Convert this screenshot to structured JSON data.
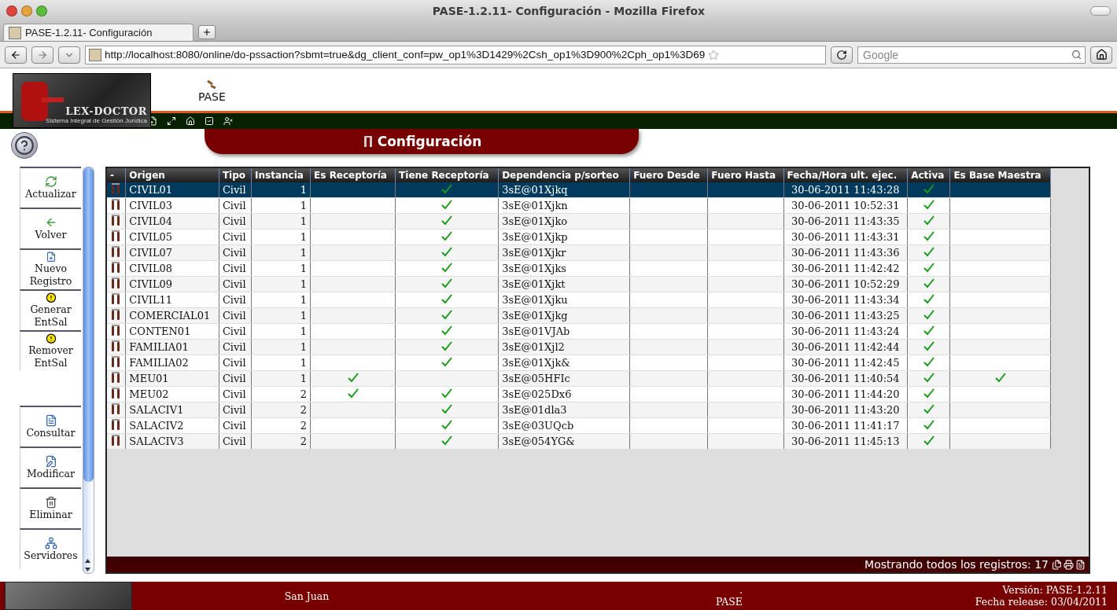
{
  "browser": {
    "window_title": "PASE-1.2.11- Configuración - Mozilla Firefox",
    "tabs": [
      {
        "label": "PASE-1.2.11- Configuración",
        "selected": true
      }
    ],
    "url": "http://localhost:8080/online/do-pssaction?sbmt=true&dg_client_conf=pw_op1%3D1429%2Csh_op1%3D900%2Cph_op1%3D69",
    "search": {
      "placeholder": "Google"
    }
  },
  "header": {
    "logo_title": "LEX-DOCTOR",
    "logo_subtitle": "Sistema Integral de Gestión Jurídica",
    "app_menu": [
      {
        "label": "PASE"
      }
    ]
  },
  "page_title": "Configuración",
  "side_groups": [
    {
      "items": [
        {
          "label": "Actualizar",
          "kind": "refresh"
        },
        {
          "label": "Volver",
          "kind": "back"
        },
        {
          "label": "Nuevo Registro",
          "kind": "new"
        },
        {
          "label": "Generar EntSal",
          "kind": "warning"
        },
        {
          "label": "Remover EntSal",
          "kind": "warning"
        }
      ]
    },
    {
      "items": [
        {
          "label": "Consultar",
          "kind": "query"
        },
        {
          "label": "Modificar",
          "kind": "edit"
        },
        {
          "label": "Eliminar",
          "kind": "delete"
        },
        {
          "label": "Servidores",
          "kind": "servers"
        }
      ]
    }
  ],
  "table": {
    "columns": [
      "-",
      "Origen",
      "Tipo",
      "Instancia",
      "Es Receptoría",
      "Tiene Receptoría",
      "Dependencia p/sorteo",
      "Fuero Desde",
      "Fuero Hasta",
      "Fecha/Hora ult. ejec.",
      "Activa",
      "Es Base Maestra"
    ],
    "rows": [
      {
        "origen": "CIVIL01",
        "tipo": "Civil",
        "instancia": "1",
        "es_receptoria": false,
        "tiene_receptoria": true,
        "dependencia": "3sE@01Xjkq",
        "fecha": "30-06-2011 11:43:28",
        "activa": true,
        "es_base_maestra": false,
        "selected": true
      },
      {
        "origen": "CIVIL03",
        "tipo": "Civil",
        "instancia": "1",
        "es_receptoria": false,
        "tiene_receptoria": true,
        "dependencia": "3sE@01Xjkn",
        "fecha": "30-06-2011 10:52:31",
        "activa": true,
        "es_base_maestra": false,
        "selected": false
      },
      {
        "origen": "CIVIL04",
        "tipo": "Civil",
        "instancia": "1",
        "es_receptoria": false,
        "tiene_receptoria": true,
        "dependencia": "3sE@01Xjko",
        "fecha": "30-06-2011 11:43:35",
        "activa": true,
        "es_base_maestra": false,
        "selected": false
      },
      {
        "origen": "CIVIL05",
        "tipo": "Civil",
        "instancia": "1",
        "es_receptoria": false,
        "tiene_receptoria": true,
        "dependencia": "3sE@01Xjkp",
        "fecha": "30-06-2011 11:43:31",
        "activa": true,
        "es_base_maestra": false,
        "selected": false
      },
      {
        "origen": "CIVIL07",
        "tipo": "Civil",
        "instancia": "1",
        "es_receptoria": false,
        "tiene_receptoria": true,
        "dependencia": "3sE@01Xjkr",
        "fecha": "30-06-2011 11:43:36",
        "activa": true,
        "es_base_maestra": false,
        "selected": false
      },
      {
        "origen": "CIVIL08",
        "tipo": "Civil",
        "instancia": "1",
        "es_receptoria": false,
        "tiene_receptoria": true,
        "dependencia": "3sE@01Xjks",
        "fecha": "30-06-2011 11:42:42",
        "activa": true,
        "es_base_maestra": false,
        "selected": false
      },
      {
        "origen": "CIVIL09",
        "tipo": "Civil",
        "instancia": "1",
        "es_receptoria": false,
        "tiene_receptoria": true,
        "dependencia": "3sE@01Xjkt",
        "fecha": "30-06-2011 10:52:29",
        "activa": true,
        "es_base_maestra": false,
        "selected": false
      },
      {
        "origen": "CIVIL11",
        "tipo": "Civil",
        "instancia": "1",
        "es_receptoria": false,
        "tiene_receptoria": true,
        "dependencia": "3sE@01Xjku",
        "fecha": "30-06-2011 11:43:34",
        "activa": true,
        "es_base_maestra": false,
        "selected": false
      },
      {
        "origen": "COMERCIAL01",
        "tipo": "Civil",
        "instancia": "1",
        "es_receptoria": false,
        "tiene_receptoria": true,
        "dependencia": "3sE@01Xjkg",
        "fecha": "30-06-2011 11:43:25",
        "activa": true,
        "es_base_maestra": false,
        "selected": false
      },
      {
        "origen": "CONTEN01",
        "tipo": "Civil",
        "instancia": "1",
        "es_receptoria": false,
        "tiene_receptoria": true,
        "dependencia": "3sE@01VJAb",
        "fecha": "30-06-2011 11:43:24",
        "activa": true,
        "es_base_maestra": false,
        "selected": false
      },
      {
        "origen": "FAMILIA01",
        "tipo": "Civil",
        "instancia": "1",
        "es_receptoria": false,
        "tiene_receptoria": true,
        "dependencia": "3sE@01Xjl2",
        "fecha": "30-06-2011 11:42:44",
        "activa": true,
        "es_base_maestra": false,
        "selected": false
      },
      {
        "origen": "FAMILIA02",
        "tipo": "Civil",
        "instancia": "1",
        "es_receptoria": false,
        "tiene_receptoria": true,
        "dependencia": "3sE@01Xjk&",
        "fecha": "30-06-2011 11:42:45",
        "activa": true,
        "es_base_maestra": false,
        "selected": false
      },
      {
        "origen": "MEU01",
        "tipo": "Civil",
        "instancia": "1",
        "es_receptoria": true,
        "tiene_receptoria": false,
        "dependencia": "3sE@05HFIc",
        "fecha": "30-06-2011 11:40:54",
        "activa": true,
        "es_base_maestra": true,
        "selected": false
      },
      {
        "origen": "MEU02",
        "tipo": "Civil",
        "instancia": "2",
        "es_receptoria": true,
        "tiene_receptoria": true,
        "dependencia": "3sE@025Dx6",
        "fecha": "30-06-2011 11:44:20",
        "activa": true,
        "es_base_maestra": false,
        "selected": false
      },
      {
        "origen": "SALACIV1",
        "tipo": "Civil",
        "instancia": "2",
        "es_receptoria": false,
        "tiene_receptoria": true,
        "dependencia": "3sE@01dla3",
        "fecha": "30-06-2011 11:43:20",
        "activa": true,
        "es_base_maestra": false,
        "selected": false
      },
      {
        "origen": "SALACIV2",
        "tipo": "Civil",
        "instancia": "2",
        "es_receptoria": false,
        "tiene_receptoria": true,
        "dependencia": "3sE@03UQcb",
        "fecha": "30-06-2011 11:41:17",
        "activa": true,
        "es_base_maestra": false,
        "selected": false
      },
      {
        "origen": "SALACIV3",
        "tipo": "Civil",
        "instancia": "2",
        "es_receptoria": false,
        "tiene_receptoria": true,
        "dependencia": "3sE@054YG&",
        "fecha": "30-06-2011 11:45:13",
        "activa": true,
        "es_base_maestra": false,
        "selected": false
      }
    ],
    "status": "Mostrando todos los registros: 17"
  },
  "footer": {
    "location": "San Juan",
    "dot": ".",
    "app": "PASE",
    "version": "Versión: PASE-1.2.11",
    "release": "Fecha release: 03/04/2011"
  }
}
